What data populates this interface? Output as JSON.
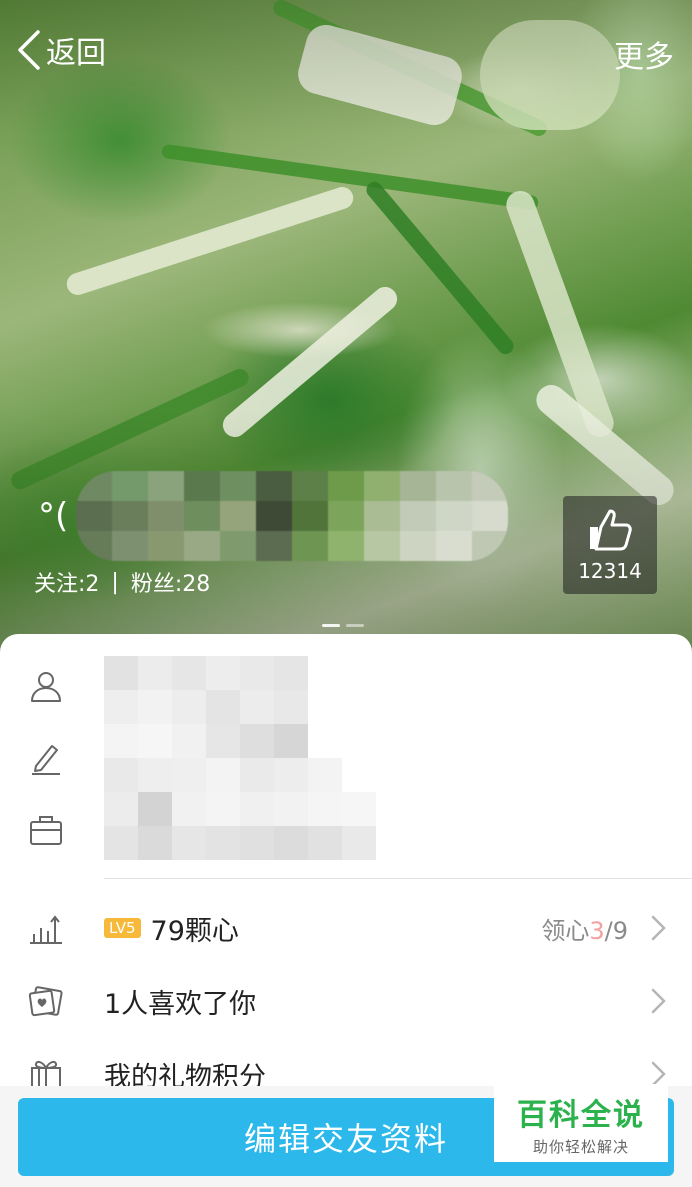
{
  "header": {
    "back_label": "返回",
    "more_label": "更多"
  },
  "profile": {
    "nickname_prefix": "°(",
    "follow_text": "关注:2",
    "separator": "|",
    "fans_text": "粉丝:28",
    "likes": "12314"
  },
  "info": {
    "bio_fragment": "週"
  },
  "menu": {
    "level_badge": "LV5",
    "hearts_label": "79颗心",
    "claim_prefix": "领心",
    "claim_current": "3",
    "claim_total": "/9",
    "liked_label": "1人喜欢了你",
    "gift_label": "我的礼物积分"
  },
  "bottom": {
    "edit_label": "编辑交友资料"
  },
  "watermark": {
    "title": "百科全说",
    "subtitle": "助你轻松解决"
  },
  "colors": {
    "accent": "#2db8ec",
    "badge": "#f7b93a",
    "watermark_green": "#2bb24c"
  }
}
